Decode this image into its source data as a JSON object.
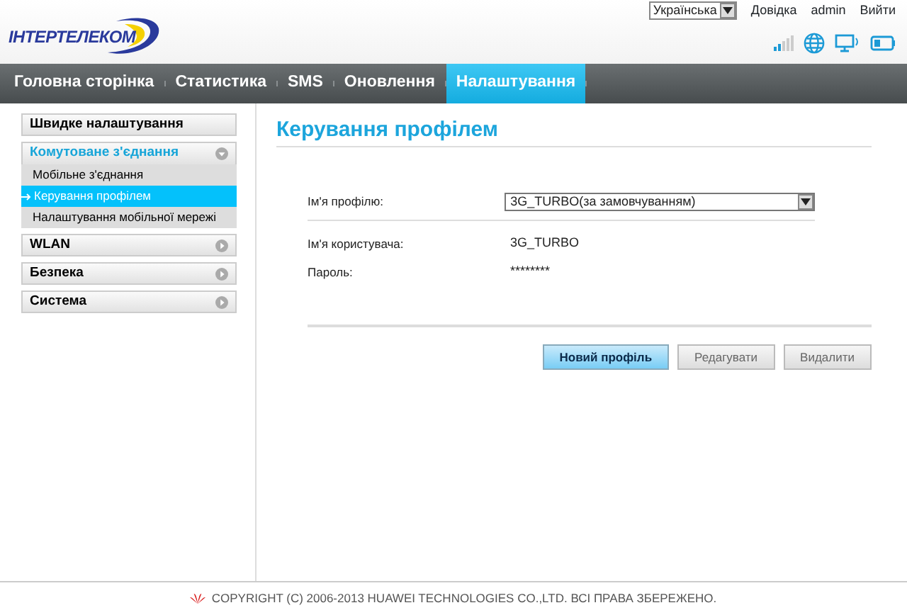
{
  "header": {
    "logo": "ІНТЕРТЕЛЕКОМ",
    "language": "Українська",
    "links": [
      "Довідка",
      "admin",
      "Вийти"
    ]
  },
  "nav": [
    {
      "label": "Головна сторінка",
      "selected": false
    },
    {
      "label": "Статистика",
      "selected": false
    },
    {
      "label": "SMS",
      "selected": false
    },
    {
      "label": "Оновлення",
      "selected": false
    },
    {
      "label": "Налаштування",
      "selected": true
    }
  ],
  "sidebar": [
    {
      "label": "Швидке налаштування",
      "kind": "plain"
    },
    {
      "label": "Комутоване з'єднання",
      "kind": "group",
      "expanded": true,
      "children": [
        {
          "label": "Мобільне з'єднання",
          "selected": false
        },
        {
          "label": "Керування профілем",
          "selected": true
        },
        {
          "label": "Налаштування мобільної мережі",
          "selected": false
        }
      ]
    },
    {
      "label": "WLAN",
      "kind": "group",
      "expanded": false
    },
    {
      "label": "Безпека",
      "kind": "group",
      "expanded": false
    },
    {
      "label": "Система",
      "kind": "group",
      "expanded": false
    }
  ],
  "page": {
    "title": "Керування профілем",
    "fields": [
      {
        "label": "Ім'я профілю:",
        "kind": "select",
        "value": "3G_TURBO(за замовчуванням)"
      },
      {
        "label": "Ім'я користувача:",
        "kind": "text",
        "value": "3G_TURBO"
      },
      {
        "label": "Пароль:",
        "kind": "text",
        "value": "********"
      }
    ],
    "buttons": [
      {
        "label": "Новий профіль",
        "kind": "primary"
      },
      {
        "label": "Редагувати",
        "kind": "secondary"
      },
      {
        "label": "Видалити",
        "kind": "secondary"
      }
    ]
  },
  "footer": {
    "copyright": "COPYRIGHT (C) 2006-2013 HUAWEI TECHNOLOGIES CO.,LTD. ВСІ ПРАВА ЗБЕРЕЖЕНО."
  }
}
